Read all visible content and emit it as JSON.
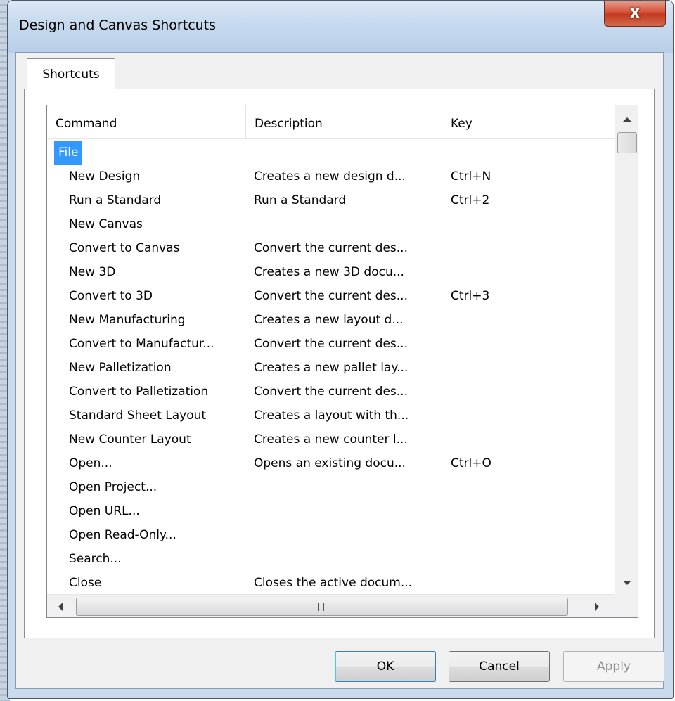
{
  "window": {
    "title": "Design and Canvas Shortcuts",
    "close_glyph": "X"
  },
  "tabs": [
    {
      "label": "Shortcuts"
    }
  ],
  "table": {
    "columns": [
      "Command",
      "Description",
      "Key"
    ],
    "category": "File",
    "rows": [
      {
        "command": "New Design",
        "description": "Creates a new design d...",
        "key": "Ctrl+N"
      },
      {
        "command": "Run a Standard",
        "description": "Run a Standard",
        "key": "Ctrl+2"
      },
      {
        "command": "New Canvas",
        "description": "",
        "key": ""
      },
      {
        "command": "Convert to Canvas",
        "description": "Convert the current des...",
        "key": ""
      },
      {
        "command": "New 3D",
        "description": "Creates a new 3D docu...",
        "key": ""
      },
      {
        "command": "Convert to 3D",
        "description": "Convert the current des...",
        "key": "Ctrl+3"
      },
      {
        "command": "New Manufacturing",
        "description": "Creates a new layout d...",
        "key": ""
      },
      {
        "command": "Convert to Manufactur...",
        "description": "Convert the current des...",
        "key": ""
      },
      {
        "command": "New Palletization",
        "description": "Creates a new pallet lay...",
        "key": ""
      },
      {
        "command": "Convert to Palletization",
        "description": "Convert the current des...",
        "key": ""
      },
      {
        "command": "Standard Sheet Layout",
        "description": "Creates a layout with th...",
        "key": ""
      },
      {
        "command": "New Counter Layout",
        "description": "Creates a new counter l...",
        "key": ""
      },
      {
        "command": "Open...",
        "description": "Opens an existing docu...",
        "key": "Ctrl+O"
      },
      {
        "command": "Open Project...",
        "description": "",
        "key": ""
      },
      {
        "command": "Open URL...",
        "description": "",
        "key": ""
      },
      {
        "command": "Open Read-Only...",
        "description": "",
        "key": ""
      },
      {
        "command": "Search...",
        "description": "",
        "key": ""
      },
      {
        "command": "Close",
        "description": "Closes the active docum...",
        "key": ""
      }
    ]
  },
  "buttons": {
    "ok": "OK",
    "cancel": "Cancel",
    "apply": "Apply"
  },
  "colors": {
    "selection": "#3399ff",
    "close_button": "#c43a20",
    "window_frame": "#c9dbec"
  }
}
